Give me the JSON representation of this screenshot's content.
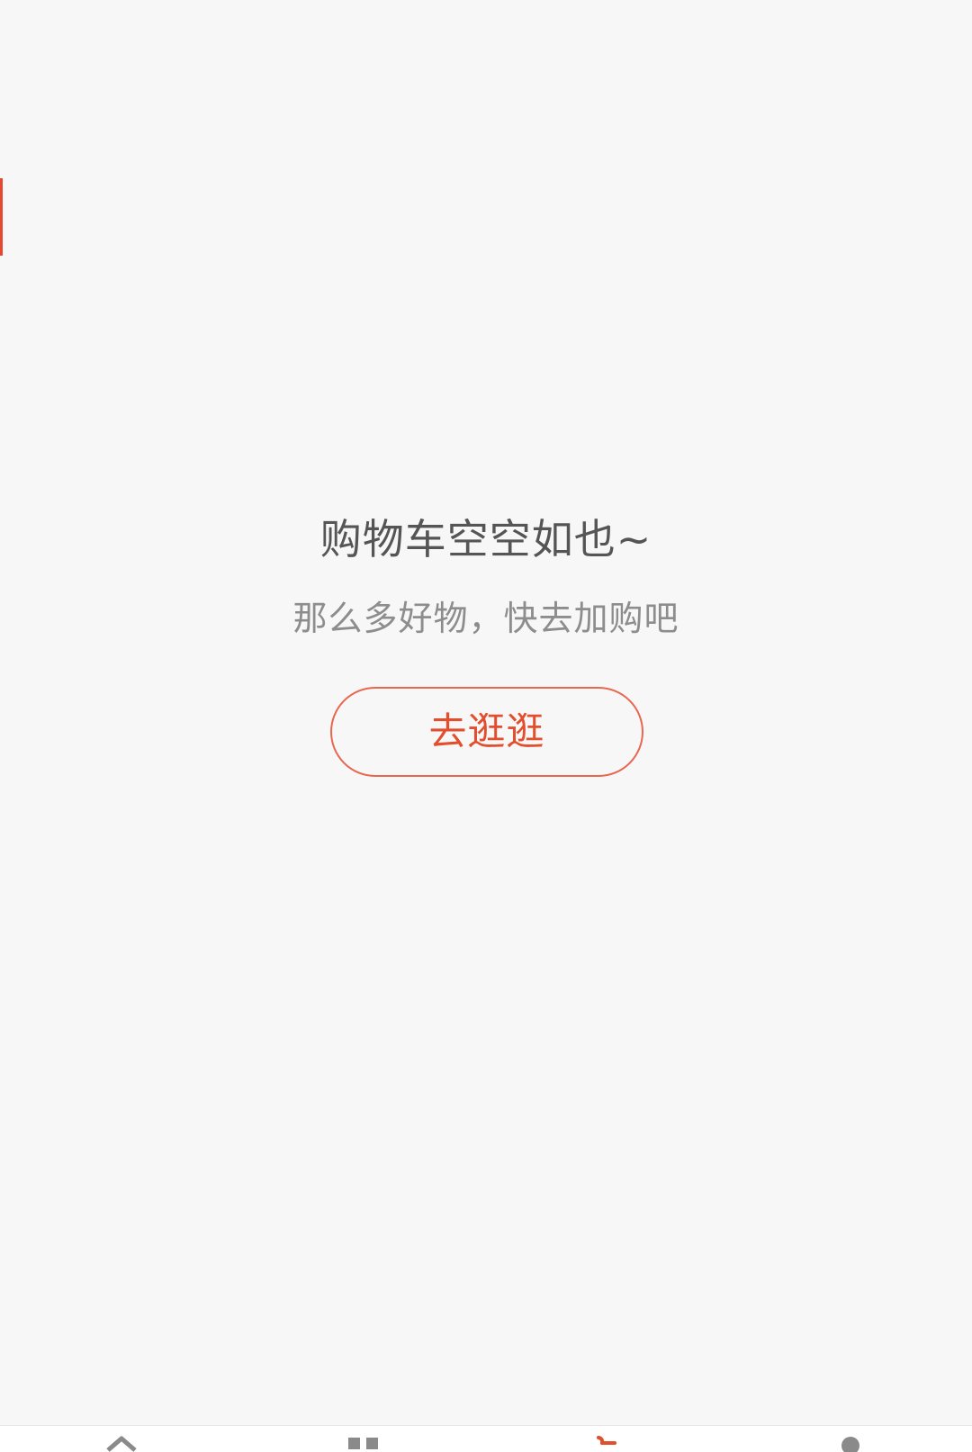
{
  "cart": {
    "empty_title": "购物车空空如也~",
    "empty_subtitle": "那么多好物，快去加购吧",
    "browse_button": "去逛逛"
  },
  "bottom_nav": {
    "items": [
      {
        "icon": "home-icon",
        "active": false
      },
      {
        "icon": "category-icon",
        "active": false
      },
      {
        "icon": "cart-icon",
        "active": true
      },
      {
        "icon": "user-icon",
        "active": false
      }
    ]
  },
  "colors": {
    "background": "#f7f7f7",
    "accent": "#e24f2f",
    "title_text": "#555555",
    "subtitle_text": "#8d8d8d",
    "inactive_icon": "#8a8a8a"
  }
}
